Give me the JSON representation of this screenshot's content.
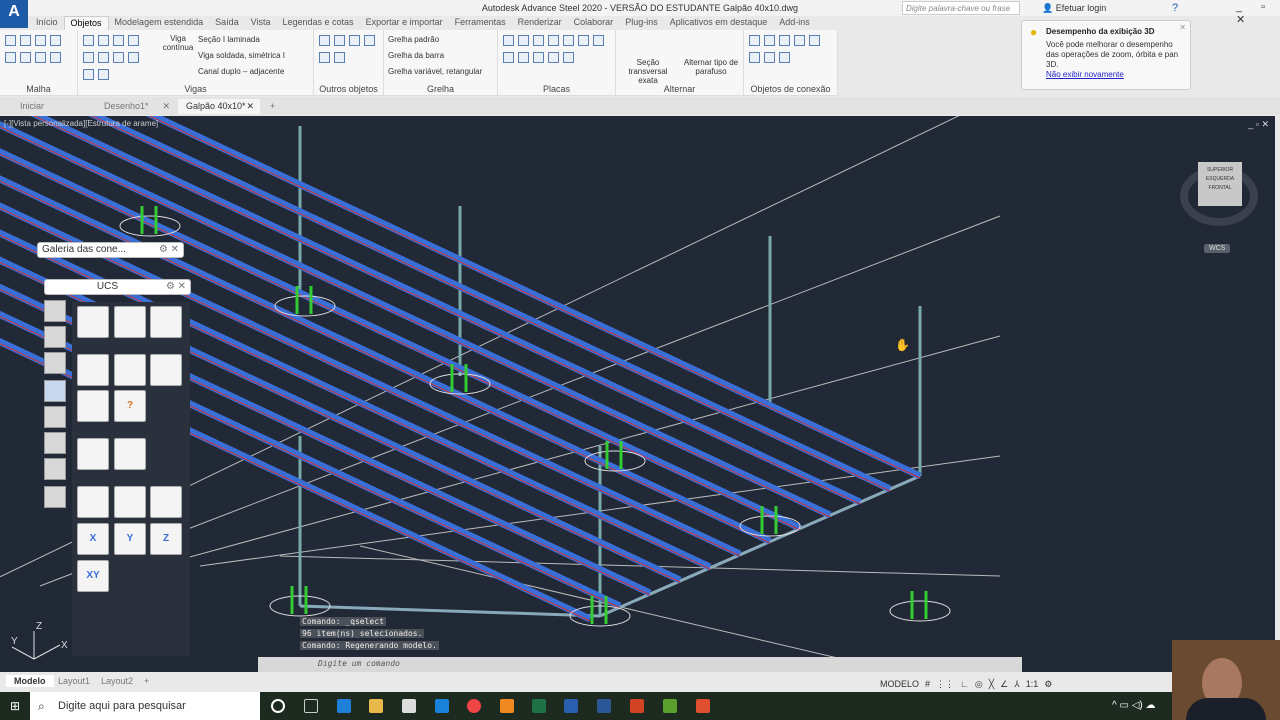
{
  "window": {
    "title": "Autodesk Advance Steel 2020 - VERSÃO DO ESTUDANTE   Galpão 40x10.dwg",
    "logo": "A",
    "search_placeholder": "Digite palavra-chave ou frase",
    "login": "Efetuar login"
  },
  "ribbon_tabs": [
    "Início",
    "Objetos",
    "Modelagem estendida",
    "Saída",
    "Vista",
    "Legendas e cotas",
    "Exportar e importar",
    "Ferramentas",
    "Renderizar",
    "Colaborar",
    "Plug-ins",
    "Aplicativos em destaque",
    "Add-ins"
  ],
  "active_tab": "Objetos",
  "panels": {
    "malha": "Malha",
    "vigas": "Vigas",
    "outros": "Outros objetos",
    "grelha": "Grelha",
    "placas": "Placas",
    "alternar": "Alternar",
    "conexao": "Objetos de conexão"
  },
  "vigas": {
    "viga_continua": "Viga contínua",
    "secao_laminada": "Seção I laminada",
    "viga_soldada": "Viga soldada, simétrica I",
    "canal_duplo": "Canal duplo – adjacente"
  },
  "grelha": {
    "padrao": "Grelha padrão",
    "barra": "Grelha da barra",
    "variavel": "Grelha variável, retangular"
  },
  "alternar": {
    "secao": "Seção transversal exata",
    "parafuso": "Alternar tipo de parafuso"
  },
  "tooltip": {
    "title": "Desempenho da exibição 3D",
    "body": "Você pode melhorar o desempenho das operações de zoom, órbita e pan 3D.",
    "link": "Não exibir novamente"
  },
  "doc_tabs": [
    "Iniciar",
    "Desenho1*",
    "Galpão 40x10*"
  ],
  "viewport": {
    "label": "[-][Vista personalizada][Estrutura de arame]",
    "viewcube": {
      "top": "SUPERIOR",
      "left": "ESQUERDA",
      "front": "FRONTAL",
      "wcs": "WCS"
    },
    "axes": {
      "x": "X",
      "y": "Y",
      "z": "Z"
    }
  },
  "palettes": {
    "gallery": "Galeria das cone...",
    "ucs": "UCS",
    "ucs_buttons": [
      "X",
      "Y",
      "Z",
      "XY"
    ]
  },
  "command": {
    "history": [
      "Comando:  _qselect",
      "96 item(ns) selecionados.",
      "Comando:  Regenerando modelo."
    ],
    "placeholder": "Digite um comando"
  },
  "layout_tabs": [
    "Modelo",
    "Layout1",
    "Layout2"
  ],
  "status": {
    "mode": "MODELO",
    "scale": "1:1"
  },
  "taskbar": {
    "search": "Digite aqui para pesquisar"
  }
}
